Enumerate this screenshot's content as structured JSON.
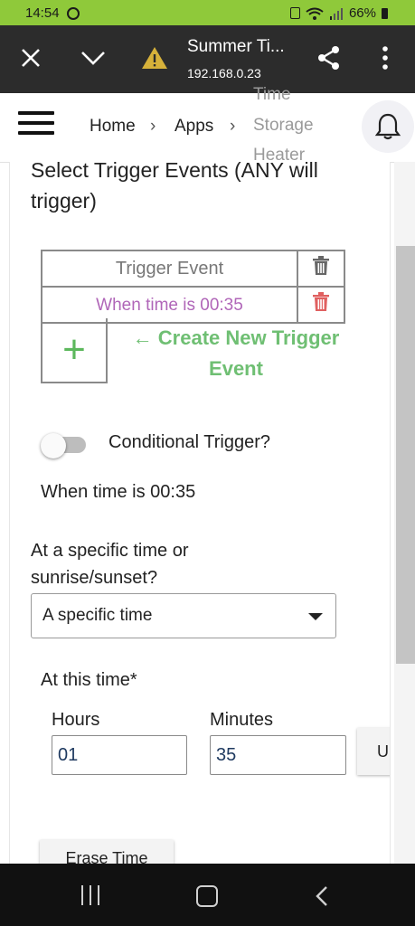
{
  "status_bar": {
    "time": "14:54",
    "battery": "66%"
  },
  "browser": {
    "title": "Summer Ti...",
    "url": "192.168.0.23"
  },
  "breadcrumb": {
    "home": "Home",
    "apps": "Apps",
    "page_line1": "Time",
    "page_line2": "Storage",
    "page_line3": "Heater"
  },
  "section": {
    "heading": "Select Trigger Events (ANY will trigger)"
  },
  "trigger_table": {
    "header": "Trigger Event",
    "rows": [
      "When time is 00:35"
    ],
    "create_label": "← Create New Trigger Event",
    "add_symbol": "+"
  },
  "conditional": {
    "label": "Conditional Trigger?",
    "enabled": false
  },
  "summary": "When time is 00:35",
  "time_type": {
    "question": "At a specific time or sunrise/sunset?",
    "selected": "A specific time"
  },
  "time_fields": {
    "label": "At this time*",
    "hours_label": "Hours",
    "hours_value": "01",
    "minutes_label": "Minutes",
    "minutes_value": "35",
    "update_button": "U"
  },
  "erase_button": "Erase Time",
  "colors": {
    "status_bar": "#8fc93a",
    "browser_bar": "#2c2c2c",
    "event_text": "#b066b8",
    "create_text": "#6fbf73",
    "trash_red": "#e06060"
  }
}
